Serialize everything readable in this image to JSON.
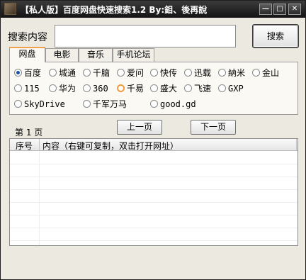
{
  "window": {
    "title": "【私人版】百度网盘快速搜索1.2    By:鉬、後再說",
    "minimize_glyph": "—",
    "maximize_glyph": "□",
    "close_glyph": "✕"
  },
  "search": {
    "label": "搜索内容",
    "value": "",
    "placeholder": "",
    "button_label": "搜索"
  },
  "tabs": [
    {
      "label": "网盘",
      "active": true
    },
    {
      "label": "电影",
      "active": false
    },
    {
      "label": "音乐",
      "active": false
    },
    {
      "label": "手机论坛",
      "active": false
    }
  ],
  "sources": [
    {
      "label": "百度",
      "checked": true
    },
    {
      "label": "城通",
      "checked": false
    },
    {
      "label": "千脑",
      "checked": false
    },
    {
      "label": "爱问",
      "checked": false
    },
    {
      "label": "快传",
      "checked": false
    },
    {
      "label": "迅载",
      "checked": false
    },
    {
      "label": "納米",
      "checked": false
    },
    {
      "label": "金山",
      "checked": false
    },
    {
      "label": "115",
      "checked": false
    },
    {
      "label": "华为",
      "checked": false
    },
    {
      "label": "360",
      "checked": false
    },
    {
      "label": "千易",
      "checked": false,
      "hover": true
    },
    {
      "label": "盛大",
      "checked": false
    },
    {
      "label": "飞速",
      "checked": false
    },
    {
      "label": "GXP",
      "checked": false
    },
    {
      "label": "SkyDrive",
      "checked": false
    },
    {
      "label": "千军万马",
      "checked": false
    },
    {
      "label": "good.gd",
      "checked": false
    }
  ],
  "pagination": {
    "page_label": "第 1 页",
    "prev_label": "上一页",
    "next_label": "下一页"
  },
  "results": {
    "columns": [
      "序号",
      "内容（右键可复制，双击打开网址）"
    ],
    "rows": []
  }
}
